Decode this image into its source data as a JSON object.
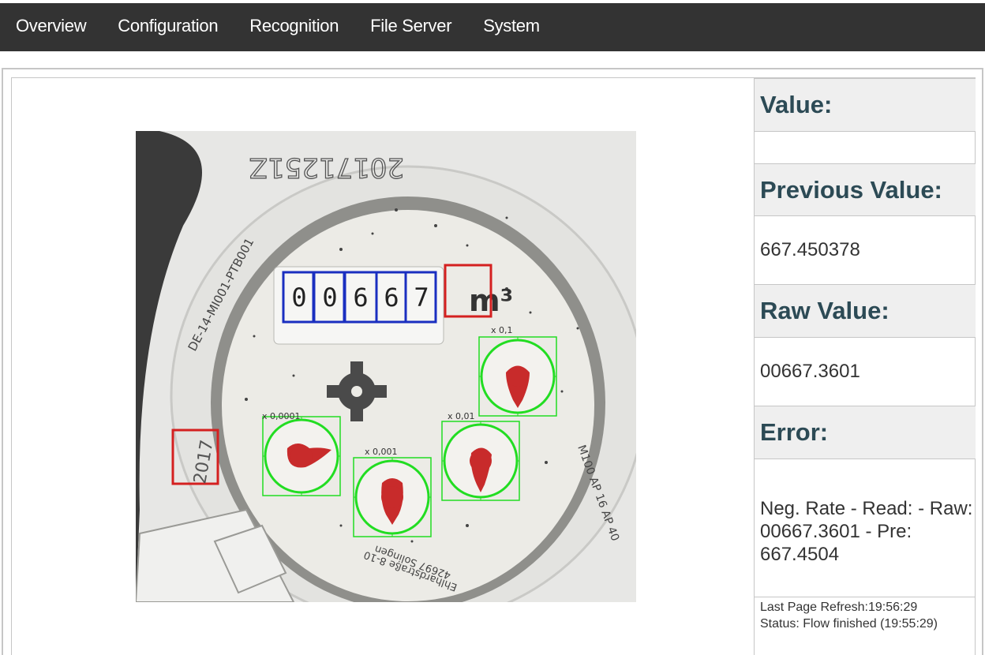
{
  "nav": {
    "items": [
      "Overview",
      "Configuration",
      "Recognition",
      "File Server",
      "System"
    ]
  },
  "meter": {
    "serial": "20171251Z",
    "model_text": "DE-14-MI001-PTB001",
    "digits": [
      "0",
      "0",
      "6",
      "6",
      "7"
    ],
    "unit": "m³",
    "year": "2017",
    "manufacturer": "42697 Solingen",
    "address": "Ehlhardstraße 8-10",
    "class_text": "M100 AP 16 AP 40",
    "dial_labels": [
      "x 0,0001",
      "x 0,001",
      "x 0,01",
      "x 0,1"
    ]
  },
  "panel": {
    "value_label": "Value:",
    "value": "",
    "previous_label": "Previous Value:",
    "previous_value": "667.450378",
    "raw_label": "Raw Value:",
    "raw_value": "00667.3601",
    "error_label": "Error:",
    "error_value": "Neg. Rate - Read: - Raw: 00667.3601 - Pre: 667.4504",
    "refresh": "Last Page Refresh:19:56:29",
    "status": "Status: Flow finished (19:55:29)"
  },
  "colors": {
    "nav_bg": "#333333",
    "digit_roi": "#1a2fc0",
    "unit_roi": "#d42020",
    "analog_roi": "#22dd22",
    "header_text": "#2c4a55"
  }
}
